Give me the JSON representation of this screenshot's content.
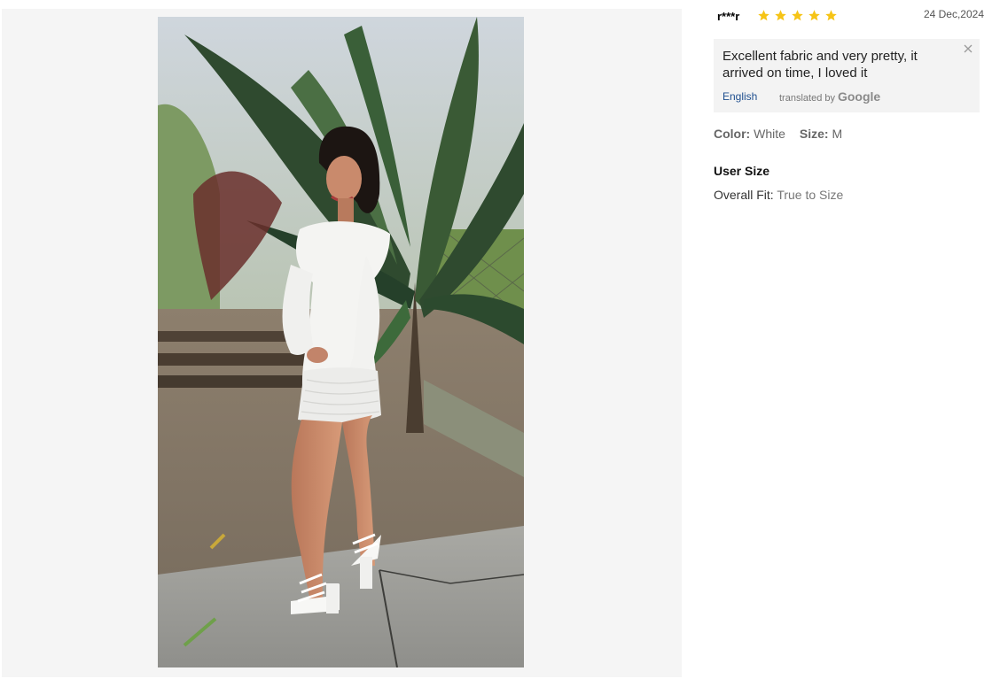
{
  "review": {
    "user": "r***r",
    "rating": 5,
    "date": "24 Dec,2024",
    "text": "Excellent fabric and very pretty, it arrived on time, I loved it",
    "language_link": "English",
    "translated_by_label": "translated by",
    "translated_by_brand": "Google",
    "color_label": "Color:",
    "color_value": "White",
    "size_label": "Size:",
    "size_value": "M",
    "user_size_title": "User Size",
    "overall_fit_label": "Overall Fit:",
    "overall_fit_value": "True to Size"
  },
  "colors": {
    "star": "#f6c416",
    "panel_bg": "#f5f5f5",
    "translate_bg": "#f3f3f3",
    "link": "#1f4f8f"
  },
  "icons": {
    "star": "star-icon",
    "close": "close-icon"
  }
}
